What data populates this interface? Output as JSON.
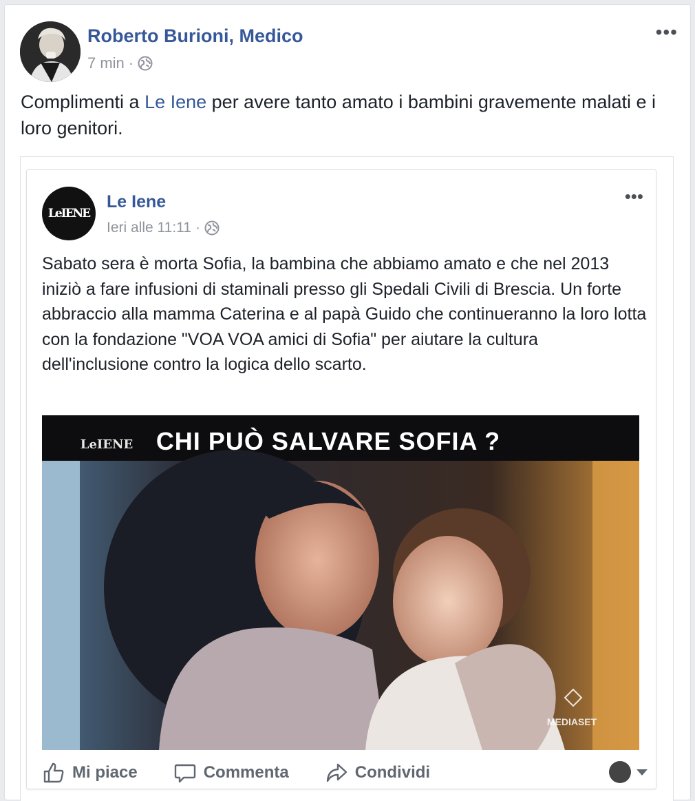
{
  "post": {
    "author": "Roberto Burioni, Medico",
    "time": "7 min",
    "separator": "·",
    "more": "•••",
    "text_before": "Complimenti a ",
    "text_link": "Le Iene",
    "text_after": " per avere tanto amato i bambini gravemente malati e i loro genitori."
  },
  "shared": {
    "page_name": "Le Iene",
    "time": "Ieri alle 11:11",
    "separator": "·",
    "more": "•••",
    "avatar_text": "LeIENE",
    "text": "Sabato sera è morta Sofia, la bambina che abbiamo amato e che nel 2013 iniziò a fare infusioni di staminali presso gli Spedali Civili di Brescia. Un forte abbraccio alla mamma Caterina e al papà Guido che continueranno la loro lotta con la fondazione \"VOA VOA amici di Sofia\" per aiutare la cultura dell'inclusione contro la logica dello scarto.",
    "image": {
      "banner_title": "CHI PUÒ SALVARE SOFIA ?",
      "logo_text": "LeIENE",
      "watermark": "MEDIASET"
    }
  },
  "actions": {
    "like": "Mi piace",
    "comment": "Commenta",
    "share": "Condividi"
  },
  "colors": {
    "link": "#365899",
    "meta": "#90949c",
    "action": "#606770"
  }
}
